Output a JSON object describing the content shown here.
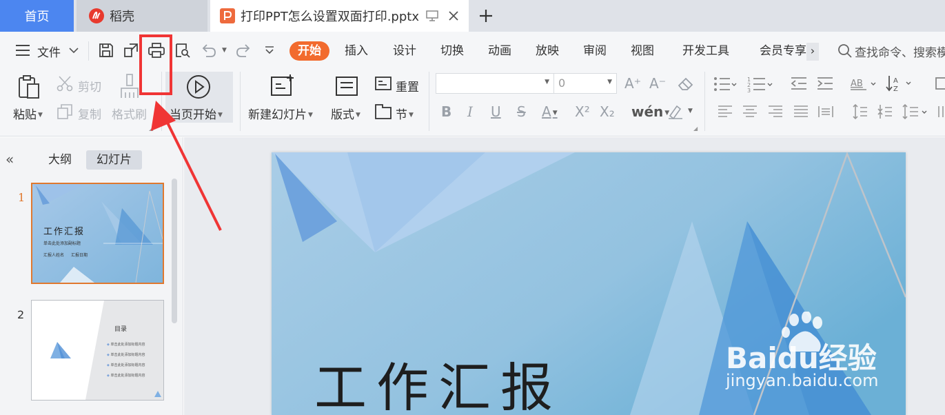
{
  "tabs": {
    "home": "首页",
    "daoke": "稻壳",
    "document": "打印PPT怎么设置双面打印.pptx",
    "add": "+"
  },
  "menubar": {
    "file": "文件",
    "ribbon_tabs": [
      "开始",
      "插入",
      "设计",
      "切换",
      "动画",
      "放映",
      "审阅",
      "视图",
      "开发工具",
      "会员专享"
    ],
    "more": "›",
    "search_placeholder": "查找命令、搜索模板"
  },
  "toolbar": {
    "paste": "粘贴",
    "cut": "剪切",
    "copy": "复制",
    "format_painter": "格式刷",
    "start_from_current": "当页开始",
    "new_slide": "新建幻灯片",
    "layout": "版式",
    "reset": "重置",
    "section": "节",
    "font_name_value": "",
    "font_size_value": "0"
  },
  "side_panel": {
    "collapse": "«",
    "tab_outline": "大纲",
    "tab_slides": "幻灯片",
    "slides": [
      {
        "number": "1",
        "title": "工作汇报",
        "subtitle": "单击此处添加副标题",
        "reporter": "汇报人姓名",
        "date": "汇报日期"
      },
      {
        "number": "2",
        "title": "目录",
        "items": [
          "单击此处添加标题内容",
          "单击此处添加标题内容",
          "单击此处添加标题内容",
          "单击此处添加标题内容"
        ]
      }
    ]
  },
  "slide_canvas": {
    "title": "工作汇报"
  },
  "watermark": {
    "brand": "Baidu经验",
    "url": "jingyan.baidu.com"
  },
  "colors": {
    "accent": "#f26b2e",
    "home_tab": "#4c86f0",
    "annotation": "#f03535"
  }
}
